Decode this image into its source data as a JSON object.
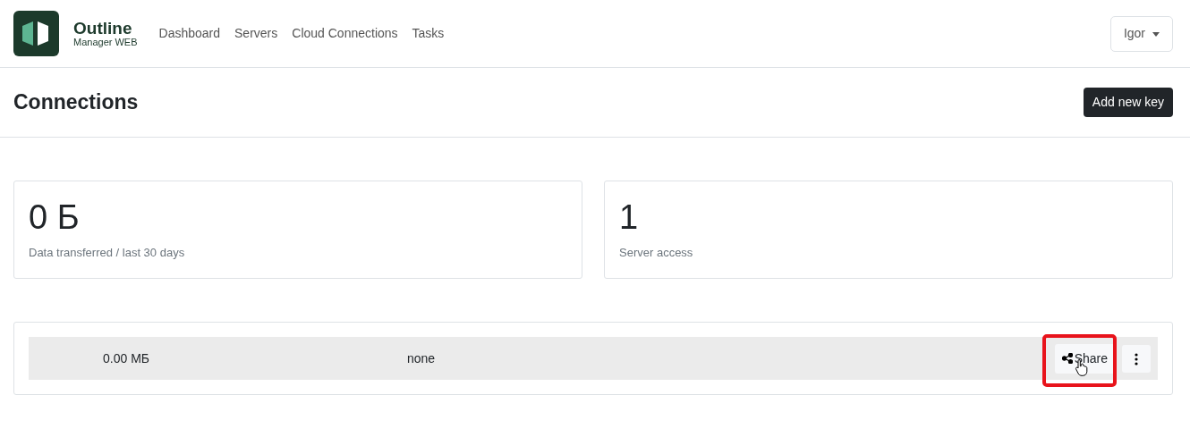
{
  "brand": {
    "title": "Outline",
    "subtitle": "Manager WEB"
  },
  "nav": [
    "Dashboard",
    "Servers",
    "Cloud Connections",
    "Tasks"
  ],
  "user_menu": {
    "label": "Igor"
  },
  "page": {
    "title": "Connections",
    "action": "Add new key"
  },
  "stats": [
    {
      "value": "0 Б",
      "label": "Data transferred / last 30 days"
    },
    {
      "value": "1",
      "label": "Server access"
    }
  ],
  "keys": [
    {
      "usage": "0.00 МБ",
      "limit": "none",
      "share": "Share",
      "highlighted": true
    }
  ]
}
